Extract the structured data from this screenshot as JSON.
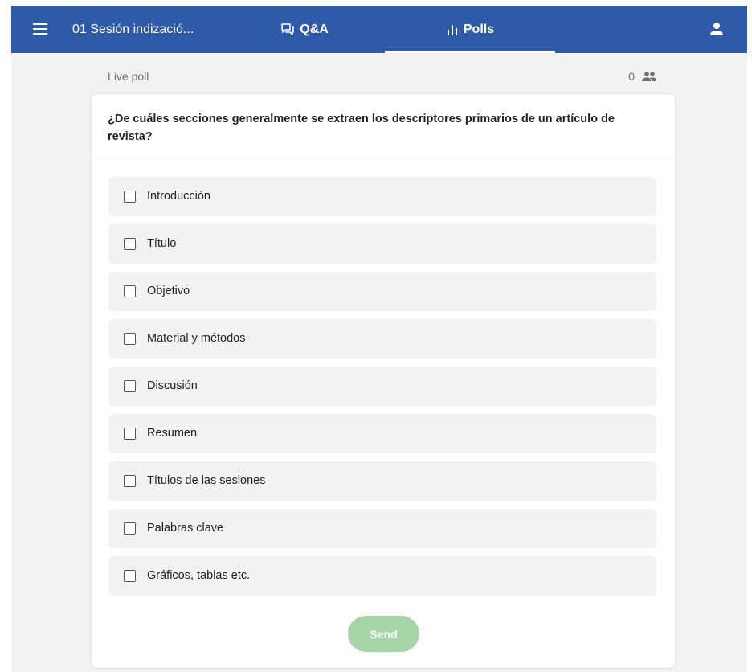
{
  "header": {
    "session_title": "01 Sesión indizació...",
    "tabs": [
      {
        "label": "Q&A",
        "icon": "chat-bubbles-icon"
      },
      {
        "label": "Polls",
        "icon": "bar-chart-icon",
        "active": true
      }
    ],
    "user_icon": "user-icon"
  },
  "poll": {
    "status_label": "Live poll",
    "participant_count": "0",
    "participants_icon": "people-icon",
    "question": "¿De cuáles secciones generalmente se extraen los descriptores primarios de un artículo de revista?",
    "options": [
      {
        "label": "Introducción",
        "checked": false
      },
      {
        "label": "Título",
        "checked": false
      },
      {
        "label": "Objetivo",
        "checked": false
      },
      {
        "label": "Material y métodos",
        "checked": false
      },
      {
        "label": "Discusión",
        "checked": false
      },
      {
        "label": "Resumen",
        "checked": false
      },
      {
        "label": "Títulos de las sesiones",
        "checked": false
      },
      {
        "label": "Palabras clave",
        "checked": false
      },
      {
        "label": "Gráficos, tablas etc.",
        "checked": false
      }
    ],
    "send_label": "Send"
  },
  "colors": {
    "header_bg": "#2e5aa8",
    "page_bg": "#f2f2f2",
    "send_disabled": "#a6d6a8"
  }
}
